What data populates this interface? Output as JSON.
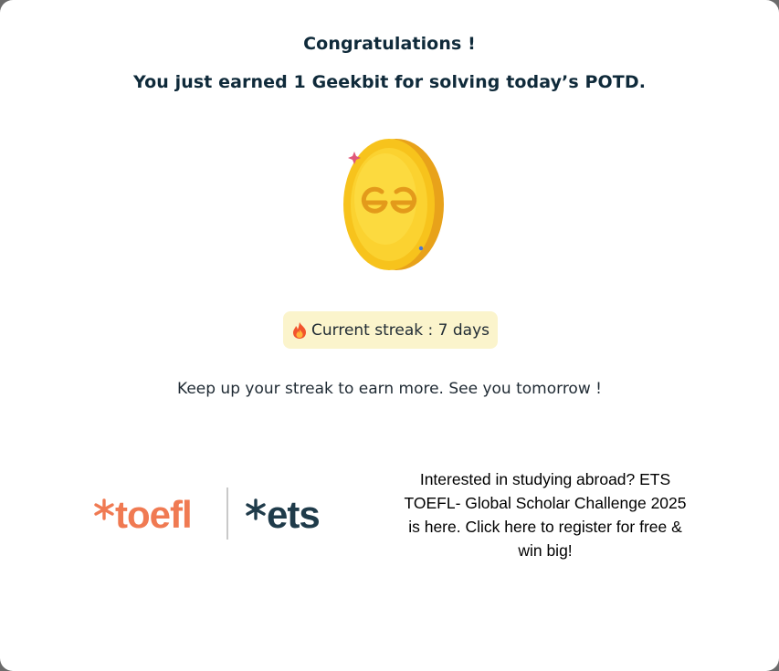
{
  "popup": {
    "title": "Congratulations !",
    "subtitle": "You just earned 1 Geekbit for solving today’s POTD.",
    "coin_icon": "geekbit-coin-icon",
    "streak": {
      "icon": "fire-icon",
      "text": "Current streak : 7 days"
    },
    "message": "Keep up your streak to earn more. See you tomorrow !"
  },
  "promo": {
    "logo_left": "toefl",
    "logo_right": "ets",
    "text": "Interested in studying abroad? ETS TOEFL- Global Scholar Challenge 2025 is here. Click here to register for free & win big!"
  },
  "colors": {
    "title": "#0f2a3a",
    "coin": "#f5c518",
    "streak_bg": "#fbf4cc",
    "toefl": "#f07a52",
    "ets": "#1f3b4a"
  }
}
